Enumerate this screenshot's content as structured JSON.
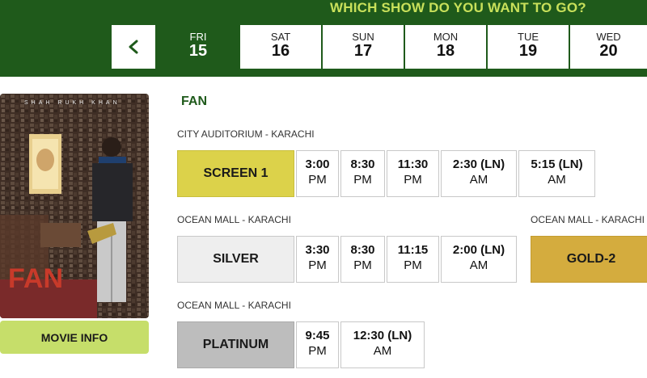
{
  "header": {
    "title": "WHICH SHOW DO YOU WANT TO GO?"
  },
  "days": [
    {
      "name": "FRI",
      "num": "15"
    },
    {
      "name": "SAT",
      "num": "16"
    },
    {
      "name": "SUN",
      "num": "17"
    },
    {
      "name": "MON",
      "num": "18"
    },
    {
      "name": "TUE",
      "num": "19"
    },
    {
      "name": "WED",
      "num": "20"
    }
  ],
  "movie": {
    "title": "FAN",
    "info_button": "MOVIE INFO",
    "poster_top_text": "SHAH RUKH KHAN",
    "poster_title": "FAN"
  },
  "venues": [
    {
      "name": "CITY AUDITORIUM - KARACHI",
      "screen": "SCREEN 1",
      "color": "#dcd24a",
      "times": [
        {
          "time": "3:00",
          "period": "PM"
        },
        {
          "time": "8:30",
          "period": "PM"
        },
        {
          "time": "11:30",
          "period": "PM"
        },
        {
          "time": "2:30 (LN)",
          "period": "AM"
        },
        {
          "time": "5:15 (LN)",
          "period": "AM"
        }
      ]
    },
    {
      "name": "OCEAN MALL - KARACHI",
      "screen": "SILVER",
      "color": "#eeeeee",
      "times": [
        {
          "time": "3:30",
          "period": "PM"
        },
        {
          "time": "8:30",
          "period": "PM"
        },
        {
          "time": "11:15",
          "period": "PM"
        },
        {
          "time": "2:00 (LN)",
          "period": "AM"
        }
      ]
    },
    {
      "name": "OCEAN MALL - KARACHI",
      "screen": "GOLD-2",
      "color": "#d4ac3e",
      "times": []
    },
    {
      "name": "OCEAN MALL - KARACHI",
      "screen": "PLATINUM",
      "color": "#bdbdbd",
      "times": [
        {
          "time": "9:45",
          "period": "PM"
        },
        {
          "time": "12:30 (LN)",
          "period": "AM"
        }
      ]
    }
  ]
}
